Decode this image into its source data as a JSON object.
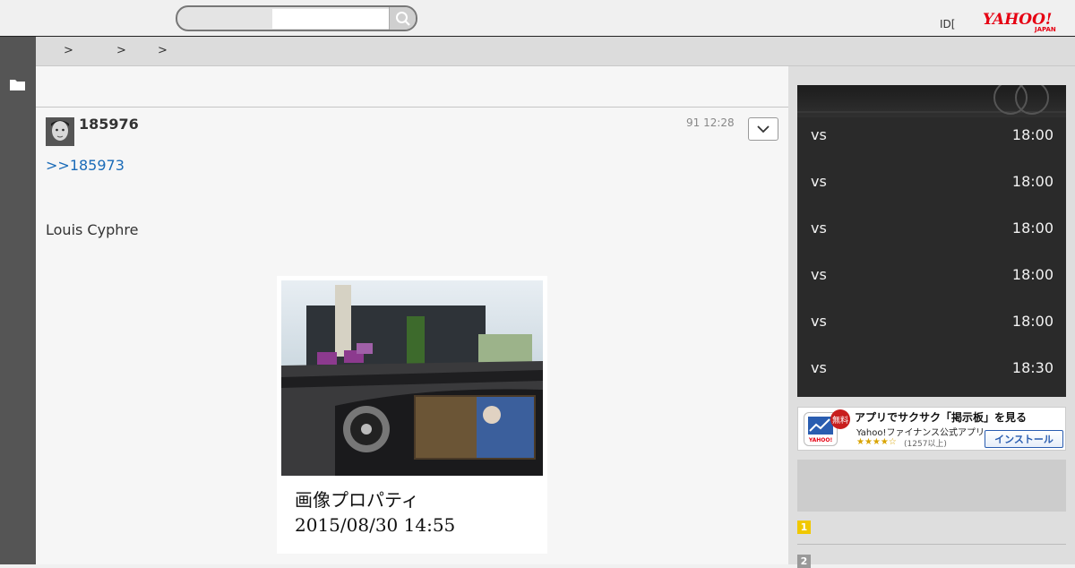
{
  "header": {
    "search_placeholder": "",
    "id_link": "ID[",
    "logo_text": "YAHOO!",
    "logo_sub": "JAPAN"
  },
  "breadcrumb": {
    "separators": [
      ">",
      ">",
      ">"
    ]
  },
  "post": {
    "number": "185976",
    "time": "91 12:28",
    "reply_link": ">>185973",
    "text": "Louis Cyphre",
    "image_caption_line1": "画像プロパティ",
    "image_caption_line2": "2015/08/30 14:55"
  },
  "schedule": {
    "matches": [
      {
        "vs": "vs",
        "time": "18:00"
      },
      {
        "vs": "vs",
        "time": "18:00"
      },
      {
        "vs": "vs",
        "time": "18:00"
      },
      {
        "vs": "vs",
        "time": "18:00"
      },
      {
        "vs": "vs",
        "time": "18:00"
      },
      {
        "vs": "vs",
        "time": "18:30"
      }
    ]
  },
  "ad": {
    "free_badge": "無料",
    "title": "アプリでサクサク「掲示板」を見る",
    "subtitle": "Yahoo!ファイナンス公式アプリ",
    "stars": "★★★★☆",
    "reviews": "(1257以上)",
    "install_label": "インストール",
    "icon_label": "YAHOO!"
  },
  "ranking": {
    "items": [
      {
        "rank": "1",
        "color": "#f0c800"
      },
      {
        "rank": "2",
        "color": "#999999"
      }
    ]
  },
  "colors": {
    "link": "#1a6bb8",
    "left_rail": "#555555",
    "logo_red": "#e60012"
  }
}
